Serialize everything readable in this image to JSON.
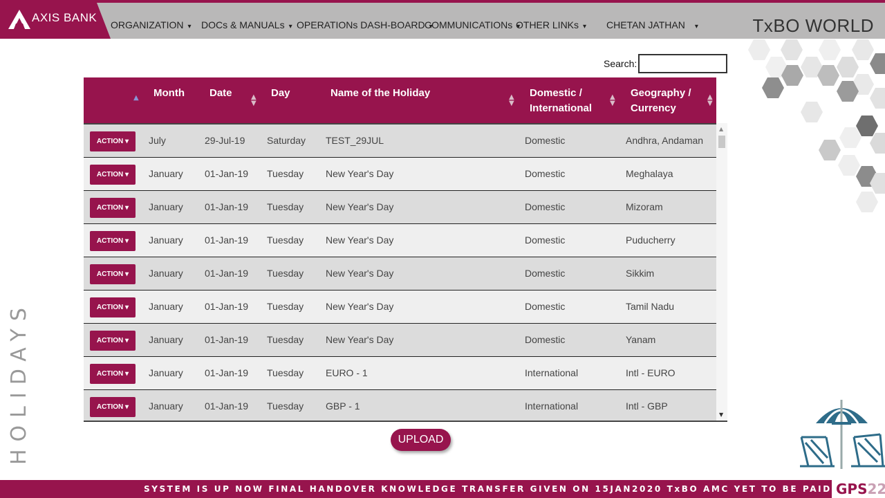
{
  "brand": {
    "name": "AXIS BANK",
    "accent": "#97144d"
  },
  "nav": {
    "items": [
      {
        "label": "ORGANIZATION",
        "caret": "▾"
      },
      {
        "label": "DOCs & MANUALs",
        "caret": "▾"
      },
      {
        "label": "OPERATIONs DASH-BOARD",
        "caret": "▾"
      },
      {
        "label": "COMMUNICATIONs",
        "caret": "▾"
      },
      {
        "label": "OTHER LINKs",
        "caret": "▾"
      },
      {
        "label": "CHETAN JATHAN",
        "caret": "▾"
      }
    ],
    "world_title": "TxBO WORLD"
  },
  "search": {
    "label": "Search:",
    "value": ""
  },
  "table": {
    "columns": [
      "Month",
      "Date",
      "Day",
      "Name of the Holiday",
      "Domestic / International",
      "Geography / Currency"
    ],
    "header_lines": {
      "domestic": [
        "Domestic /",
        "International"
      ],
      "geography": [
        "Geography /",
        "Currency"
      ]
    },
    "action_label": "ACTION",
    "rows": [
      {
        "month": "July",
        "date": "29-Jul-19",
        "day": "Saturday",
        "name": "TEST_29JUL",
        "type": "Domestic",
        "geo": "Andhra, Andaman"
      },
      {
        "month": "January",
        "date": "01-Jan-19",
        "day": "Tuesday",
        "name": "New Year's Day",
        "type": "Domestic",
        "geo": "Meghalaya"
      },
      {
        "month": "January",
        "date": "01-Jan-19",
        "day": "Tuesday",
        "name": "New Year's Day",
        "type": "Domestic",
        "geo": "Mizoram"
      },
      {
        "month": "January",
        "date": "01-Jan-19",
        "day": "Tuesday",
        "name": "New Year's Day",
        "type": "Domestic",
        "geo": "Puducherry"
      },
      {
        "month": "January",
        "date": "01-Jan-19",
        "day": "Tuesday",
        "name": "New Year's Day",
        "type": "Domestic",
        "geo": "Sikkim"
      },
      {
        "month": "January",
        "date": "01-Jan-19",
        "day": "Tuesday",
        "name": "New Year's Day",
        "type": "Domestic",
        "geo": "Tamil Nadu"
      },
      {
        "month": "January",
        "date": "01-Jan-19",
        "day": "Tuesday",
        "name": "New Year's Day",
        "type": "Domestic",
        "geo": "Yanam"
      },
      {
        "month": "January",
        "date": "01-Jan-19",
        "day": "Tuesday",
        "name": "EURO - 1",
        "type": "International",
        "geo": "Intl - EURO"
      },
      {
        "month": "January",
        "date": "01-Jan-19",
        "day": "Tuesday",
        "name": "GBP - 1",
        "type": "International",
        "geo": "Intl - GBP"
      }
    ]
  },
  "upload_label": "UPLOAD",
  "side_title": "HOLIDAYS",
  "footer": {
    "marquee": "SYSTEM IS UP NOW FINAL HANDOVER  KNOWLEDGE TRANSFER GIVEN ON 15JAN2020       TxBO AMC YET TO BE PAID TO LACEWORKS",
    "logo_letters": "GPS",
    "logo_number": "22"
  },
  "icons": {
    "sort": "sort-arrows-icon",
    "action_caret": "caret-down-icon",
    "logo": "axis-bank-logo-icon"
  }
}
